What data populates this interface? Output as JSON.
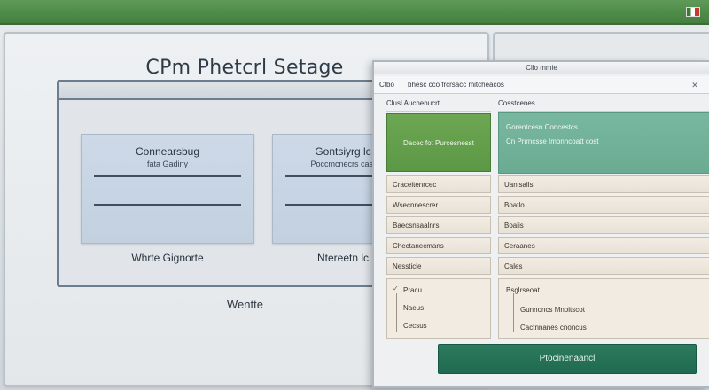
{
  "top_bar": {},
  "back_window": {
    "title": "CPm Phetcrl Setage",
    "cards": [
      {
        "title": "Connearsbug",
        "subtitle": "fata Gadiny",
        "footer": "Whrte Gignorte"
      },
      {
        "title": "Gontsiyrg lc",
        "subtitle": "Poccmcnecrs cas.",
        "footer": "Ntereetn lc"
      }
    ],
    "bottom_label": "Wentte"
  },
  "dialog": {
    "title": "Cllo mmie",
    "toolbar": {
      "left": "Ctbo",
      "middle": "bhesc cco frcrsacc mitcheacos"
    },
    "section_left": "Clusl Aucnenucrt",
    "section_right": "Cosstcenes",
    "green_tile": "Dacec fot Purcesnesst",
    "teal_tile": {
      "title": "Gorentcesn Concestcs",
      "subtitle": "Cn  Pnrncsse Imonncoatt cost"
    },
    "left_rows": [
      "Craceitenrcec",
      "Wsecnnescrer",
      "Baecsnsaalnrs",
      "Chectanecmans",
      "Nessticle"
    ],
    "right_rows": [
      "Uanlsalls",
      "Boatlo",
      "Boalis",
      "Ceraanes",
      "Cales"
    ],
    "left_tree": [
      "Pracu",
      "Naeus",
      "Cecsus"
    ],
    "right_tree": [
      "Bsglrseoat",
      "Gunnoncs Mnoitscot",
      "Cactnnanes cnoncus"
    ],
    "primary_button": "Ptocinenaancl"
  },
  "colors": {
    "top_bar": "#4e8a47",
    "green_tile": "#6da653",
    "teal_tile": "#79b8a0",
    "primary_button": "#1f6a50"
  }
}
